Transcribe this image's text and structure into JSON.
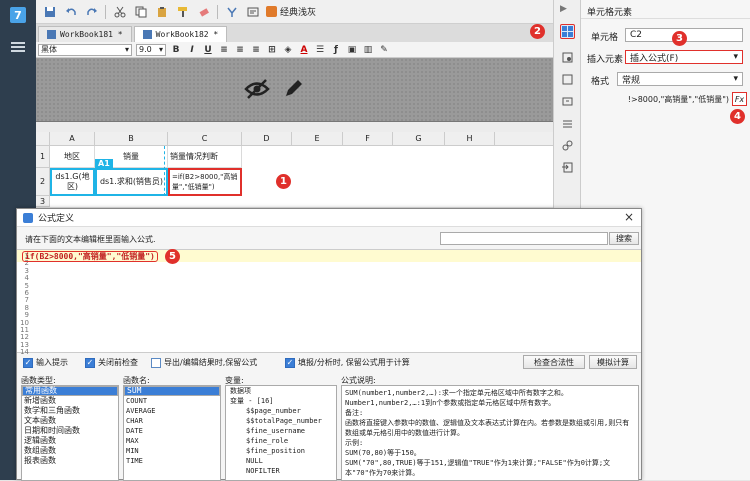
{
  "toolbar": {
    "theme_label": "经典浅灰"
  },
  "tabs": [
    {
      "label": "WorkBook181 *"
    },
    {
      "label": "WorkBook182 *"
    }
  ],
  "format": {
    "font_name": "黑体",
    "font_size": "9.0"
  },
  "grid": {
    "columns": [
      "A",
      "B",
      "C",
      "D",
      "E",
      "F",
      "G",
      "H"
    ],
    "rows": [
      "1",
      "2",
      "3"
    ],
    "cells": {
      "A1": "地区",
      "B1": "销量",
      "C1": "销量情况判断",
      "A2": "ds1.G(地区)",
      "B2": "ds1.求和(销售员)",
      "C2": "=if(B2>8000,\"高销量\",\"低销量\")"
    },
    "cell_label": "A1"
  },
  "panel": {
    "title": "单元格元素",
    "cell_label": "单元格",
    "cell_value": "C2",
    "insert_label": "插入元素",
    "insert_value": "插入公式(F)",
    "format_label": "格式",
    "format_value": "常规",
    "formula_preview": "!>8000,\"高销量\",\"低销量\")",
    "fx_label": "Fx"
  },
  "badges": [
    "1",
    "2",
    "3",
    "4",
    "5"
  ],
  "dialog": {
    "title": "公式定义",
    "prompt": "请在下面的文本编辑框里面输入公式.",
    "search_button": "搜索",
    "formula": "if(B2>8000,\"高销量\",\"低销量\")",
    "line_numbers": [
      "1",
      "2",
      "3",
      "4",
      "5",
      "6",
      "7",
      "8",
      "9",
      "10",
      "11",
      "12",
      "13",
      "14"
    ],
    "options": [
      {
        "label": "输入提示",
        "checked": true
      },
      {
        "label": "关闭前检查",
        "checked": true
      },
      {
        "label": "导出/编辑结果时,保留公式",
        "checked": false
      },
      {
        "label": "填报/分析时, 保留公式用于计算",
        "checked": true
      }
    ],
    "check_button": "检查合法性",
    "simulate_button": "模拟计算",
    "headers": {
      "types": "函数类型:",
      "names": "函数名:",
      "vars": "变量:",
      "desc": "公式说明:"
    },
    "function_types": [
      "常用函数",
      "新增函数",
      "数学和三角函数",
      "文本函数",
      "日期和时间函数",
      "逻辑函数",
      "数组函数",
      "报表函数"
    ],
    "function_names": [
      "SUM",
      "COUNT",
      "AVERAGE",
      "CHAR",
      "DATE",
      "MAX",
      "MIN",
      "TIME"
    ],
    "variables": [
      "数据项",
      "变量 - [16]",
      "$$page_number",
      "$$totalPage_number",
      "$fine_username",
      "$fine_role",
      "$fine_position",
      "NULL",
      "NOFILTER"
    ],
    "description": [
      "SUM(number1,number2,…):求一个指定单元格区域中所有数字之和。",
      "Number1,number2,…:1到n个参数或指定单元格区域中所有数字。",
      "备注:",
      "函数将直接键入参数中的数值、逻辑值及文本表达式计算在内。若参数是数组或引用,则只有数组或单元格引用中的数值进行计算。",
      "示例:",
      "SUM(70,80)等于150。",
      "SUM(\"70\",80,TRUE)等于151,逻辑值\"TRUE\"作为1来计算;\"FALSE\"作为0计算;文本\"70\"作为70来计算。"
    ]
  },
  "colors": {
    "accent": "#3b7ed6",
    "badge": "#e0302b",
    "sidebar": "#2e3e4e"
  }
}
